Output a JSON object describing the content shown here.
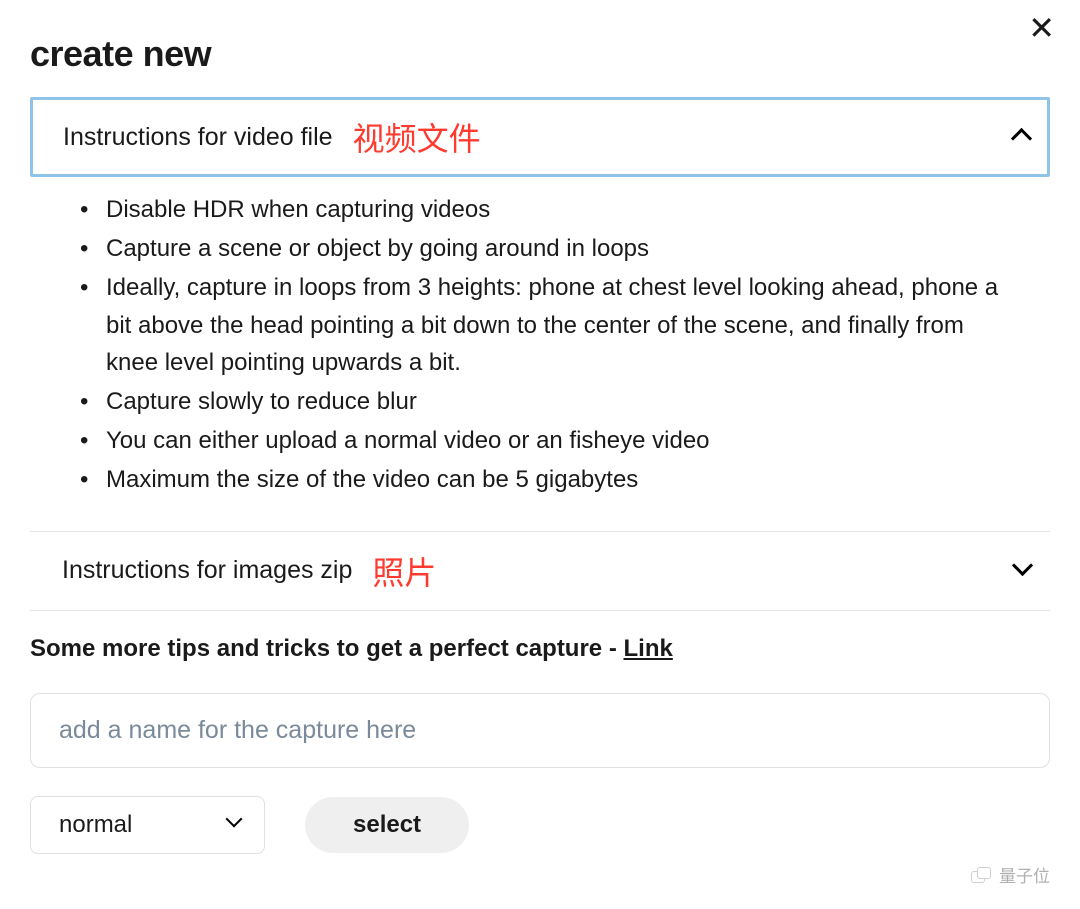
{
  "header": {
    "title": "create new"
  },
  "accordion": {
    "video": {
      "label": "Instructions for video file",
      "annotation": "视频文件",
      "expanded": true,
      "items": [
        "Disable HDR when capturing videos",
        "Capture a scene or object by going around in loops",
        "Ideally, capture in loops from 3 heights: phone at chest level looking ahead, phone a bit above the head pointing a bit down to the center of the scene, and finally from knee level pointing upwards a bit.",
        "Capture slowly to reduce blur",
        "You can either upload a normal video or an fisheye video",
        "Maximum the size of the video can be 5 gigabytes"
      ]
    },
    "images": {
      "label": "Instructions for images zip",
      "annotation": "照片",
      "expanded": false
    }
  },
  "tips": {
    "text": "Some more tips and tricks to get a perfect capture - ",
    "link_label": "Link"
  },
  "form": {
    "name_placeholder": "add a name for the capture here",
    "type_selected": "normal",
    "select_button": "select"
  },
  "watermark": {
    "text": "量子位"
  }
}
